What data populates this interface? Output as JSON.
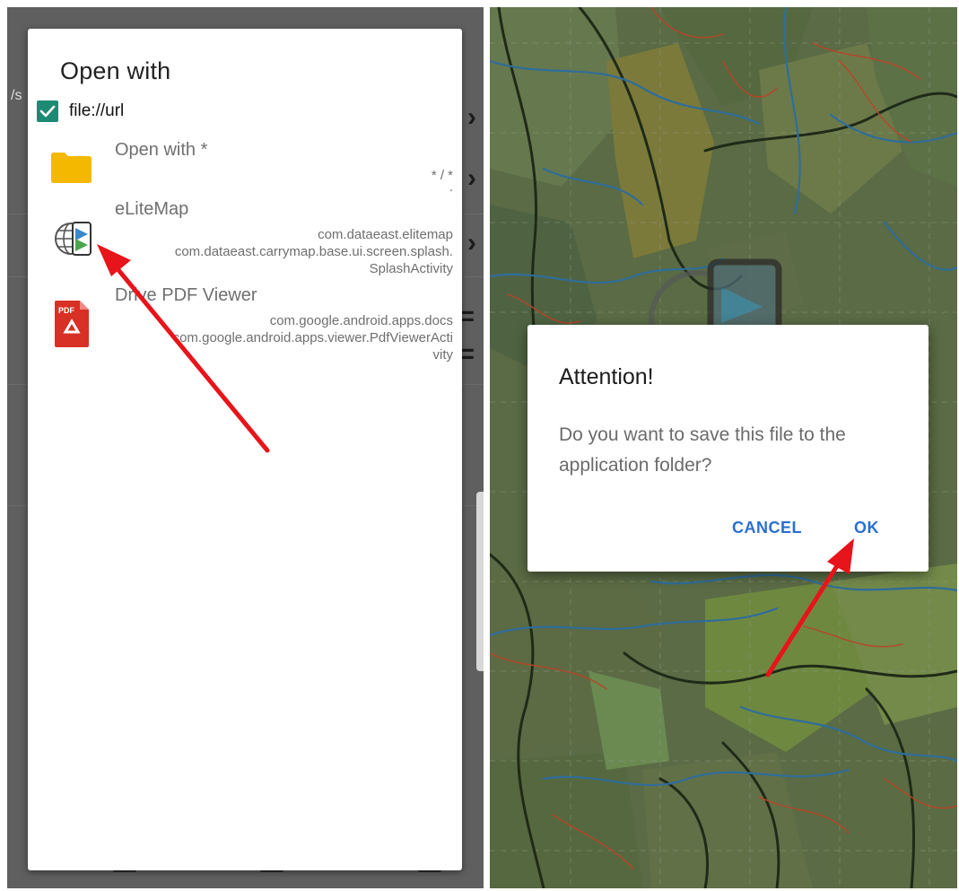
{
  "left": {
    "background_path_text": "/s",
    "dialog": {
      "title": "Open with",
      "checkbox": {
        "label": "file://url",
        "checked": true
      },
      "apps": [
        {
          "name": "Open with *",
          "detail_lines": [
            "* / *",
            "."
          ],
          "icon": "folder-icon"
        },
        {
          "name": "eLiteMap",
          "detail_lines": [
            "com.dataeast.elitemap",
            "com.dataeast.carrymap.base.ui.screen.splash.",
            "SplashActivity"
          ],
          "icon": "elitemap-icon"
        },
        {
          "name": "Drive PDF Viewer",
          "detail_lines": [
            "com.google.android.apps.docs",
            "com.google.android.apps.viewer.PdfViewerActi",
            "vity"
          ],
          "icon": "pdf-icon"
        }
      ]
    },
    "pdf_icon_text": "PDF"
  },
  "right": {
    "alert": {
      "title": "Attention!",
      "message": "Do you want to save this file to the application folder?",
      "cancel_label": "CANCEL",
      "ok_label": "OK"
    }
  },
  "colors": {
    "checkbox": "#1d8a74",
    "accent_button": "#2a6fd1",
    "annotation_arrow": "#e8141b",
    "folder": "#f5b800",
    "pdf": "#d93025"
  }
}
